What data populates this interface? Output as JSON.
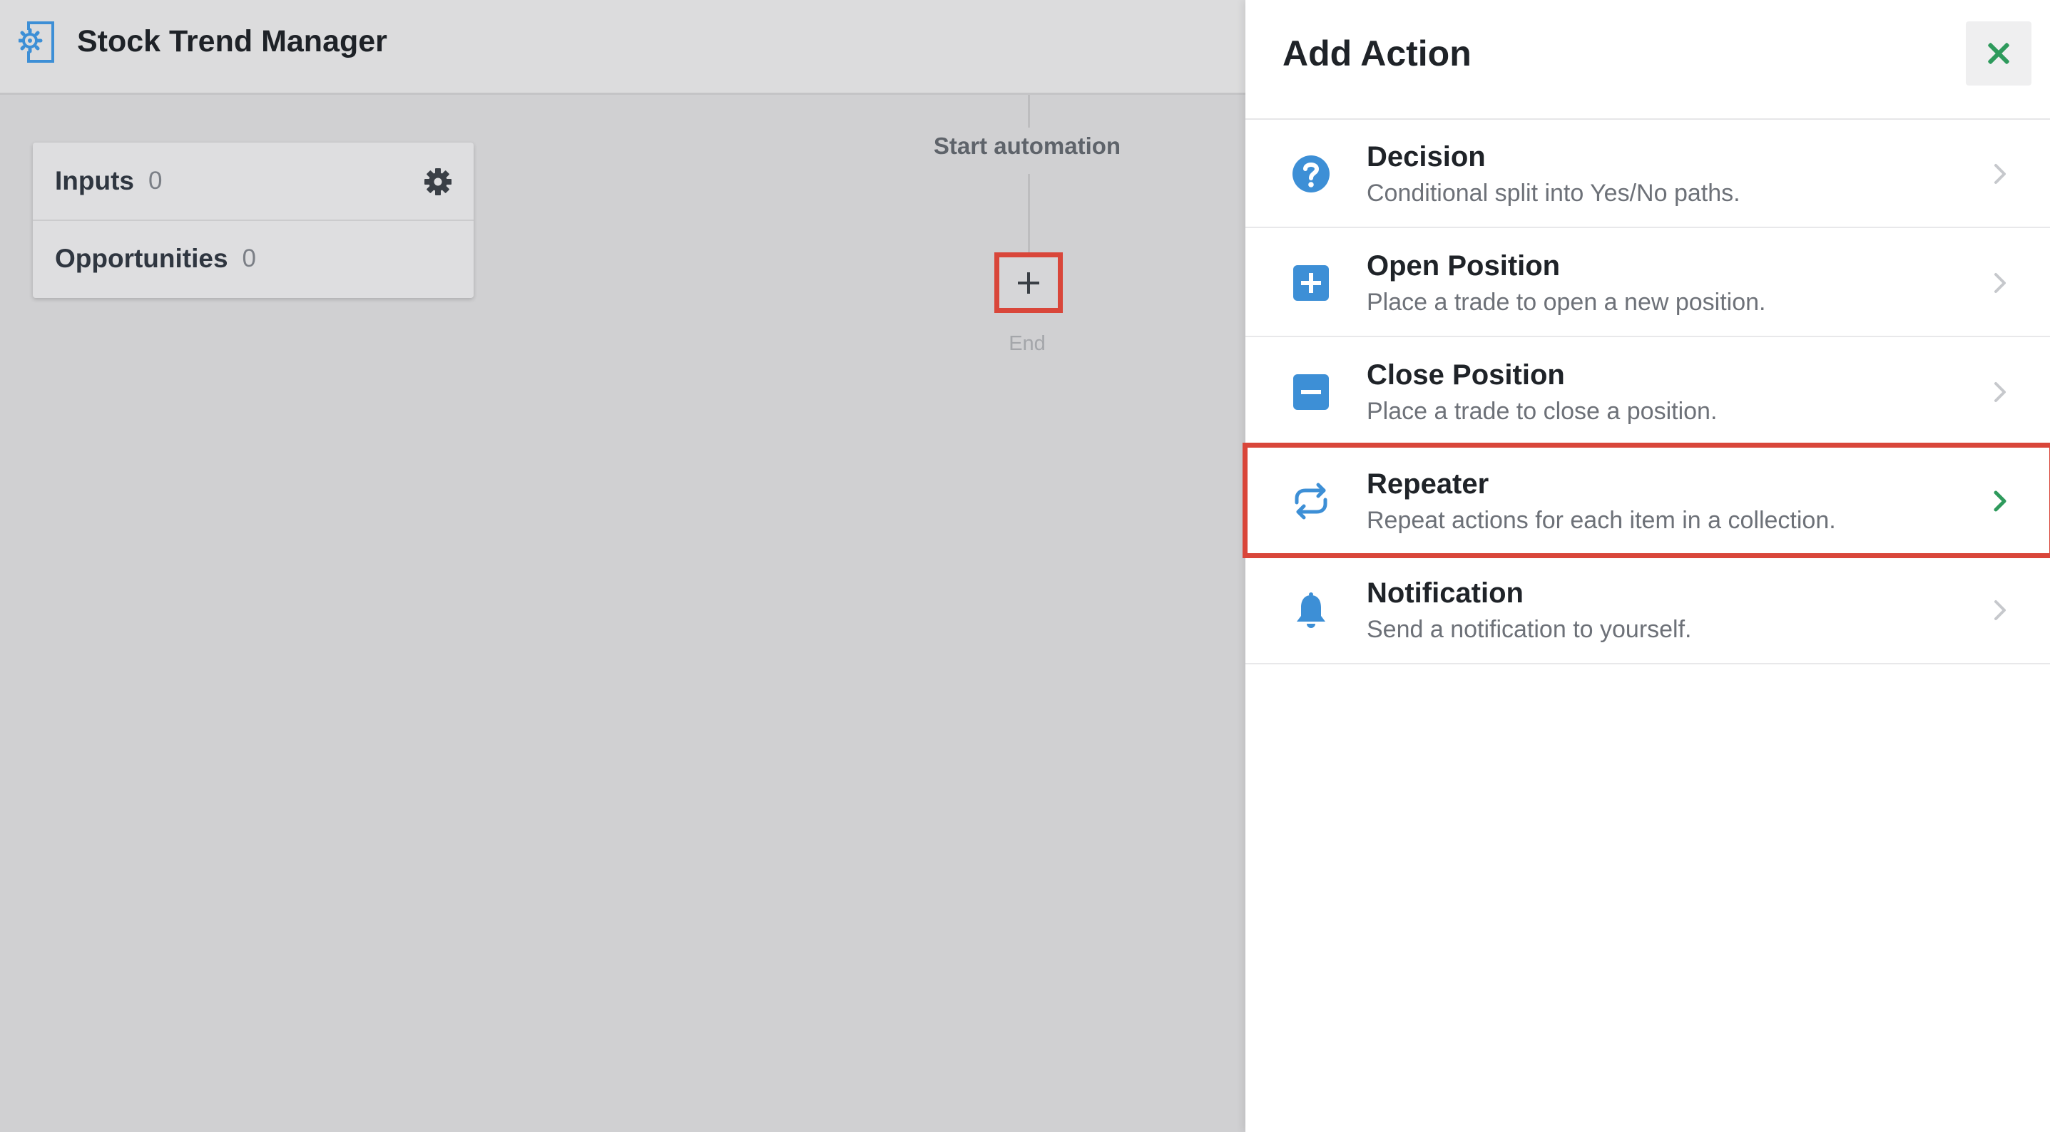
{
  "app": {
    "title": "Stock Trend Manager",
    "logo_icon": "automation-gear-icon"
  },
  "sidebar_card": {
    "rows": [
      {
        "label": "Inputs",
        "count": "0",
        "icon": "gear-icon"
      },
      {
        "label": "Opportunities",
        "count": "0"
      }
    ]
  },
  "flow": {
    "start_label": "Start automation",
    "add_button_icon": "plus-icon",
    "end_label": "End"
  },
  "panel": {
    "title": "Add Action",
    "close_icon": "close-icon",
    "actions": [
      {
        "title": "Decision",
        "description": "Conditional split into Yes/No paths.",
        "icon": "question-circle-icon"
      },
      {
        "title": "Open Position",
        "description": "Place a trade to open a new position.",
        "icon": "plus-square-icon"
      },
      {
        "title": "Close Position",
        "description": "Place a trade to close a position.",
        "icon": "minus-square-icon"
      },
      {
        "title": "Repeater",
        "description": "Repeat actions for each item in a collection.",
        "icon": "repeat-icon",
        "highlighted": true
      },
      {
        "title": "Notification",
        "description": "Send a notification to yourself.",
        "icon": "bell-icon"
      }
    ]
  },
  "colors": {
    "accent_blue": "#3d8fd6",
    "accent_green": "#2e9a5c",
    "highlight_red": "#d9463a"
  }
}
